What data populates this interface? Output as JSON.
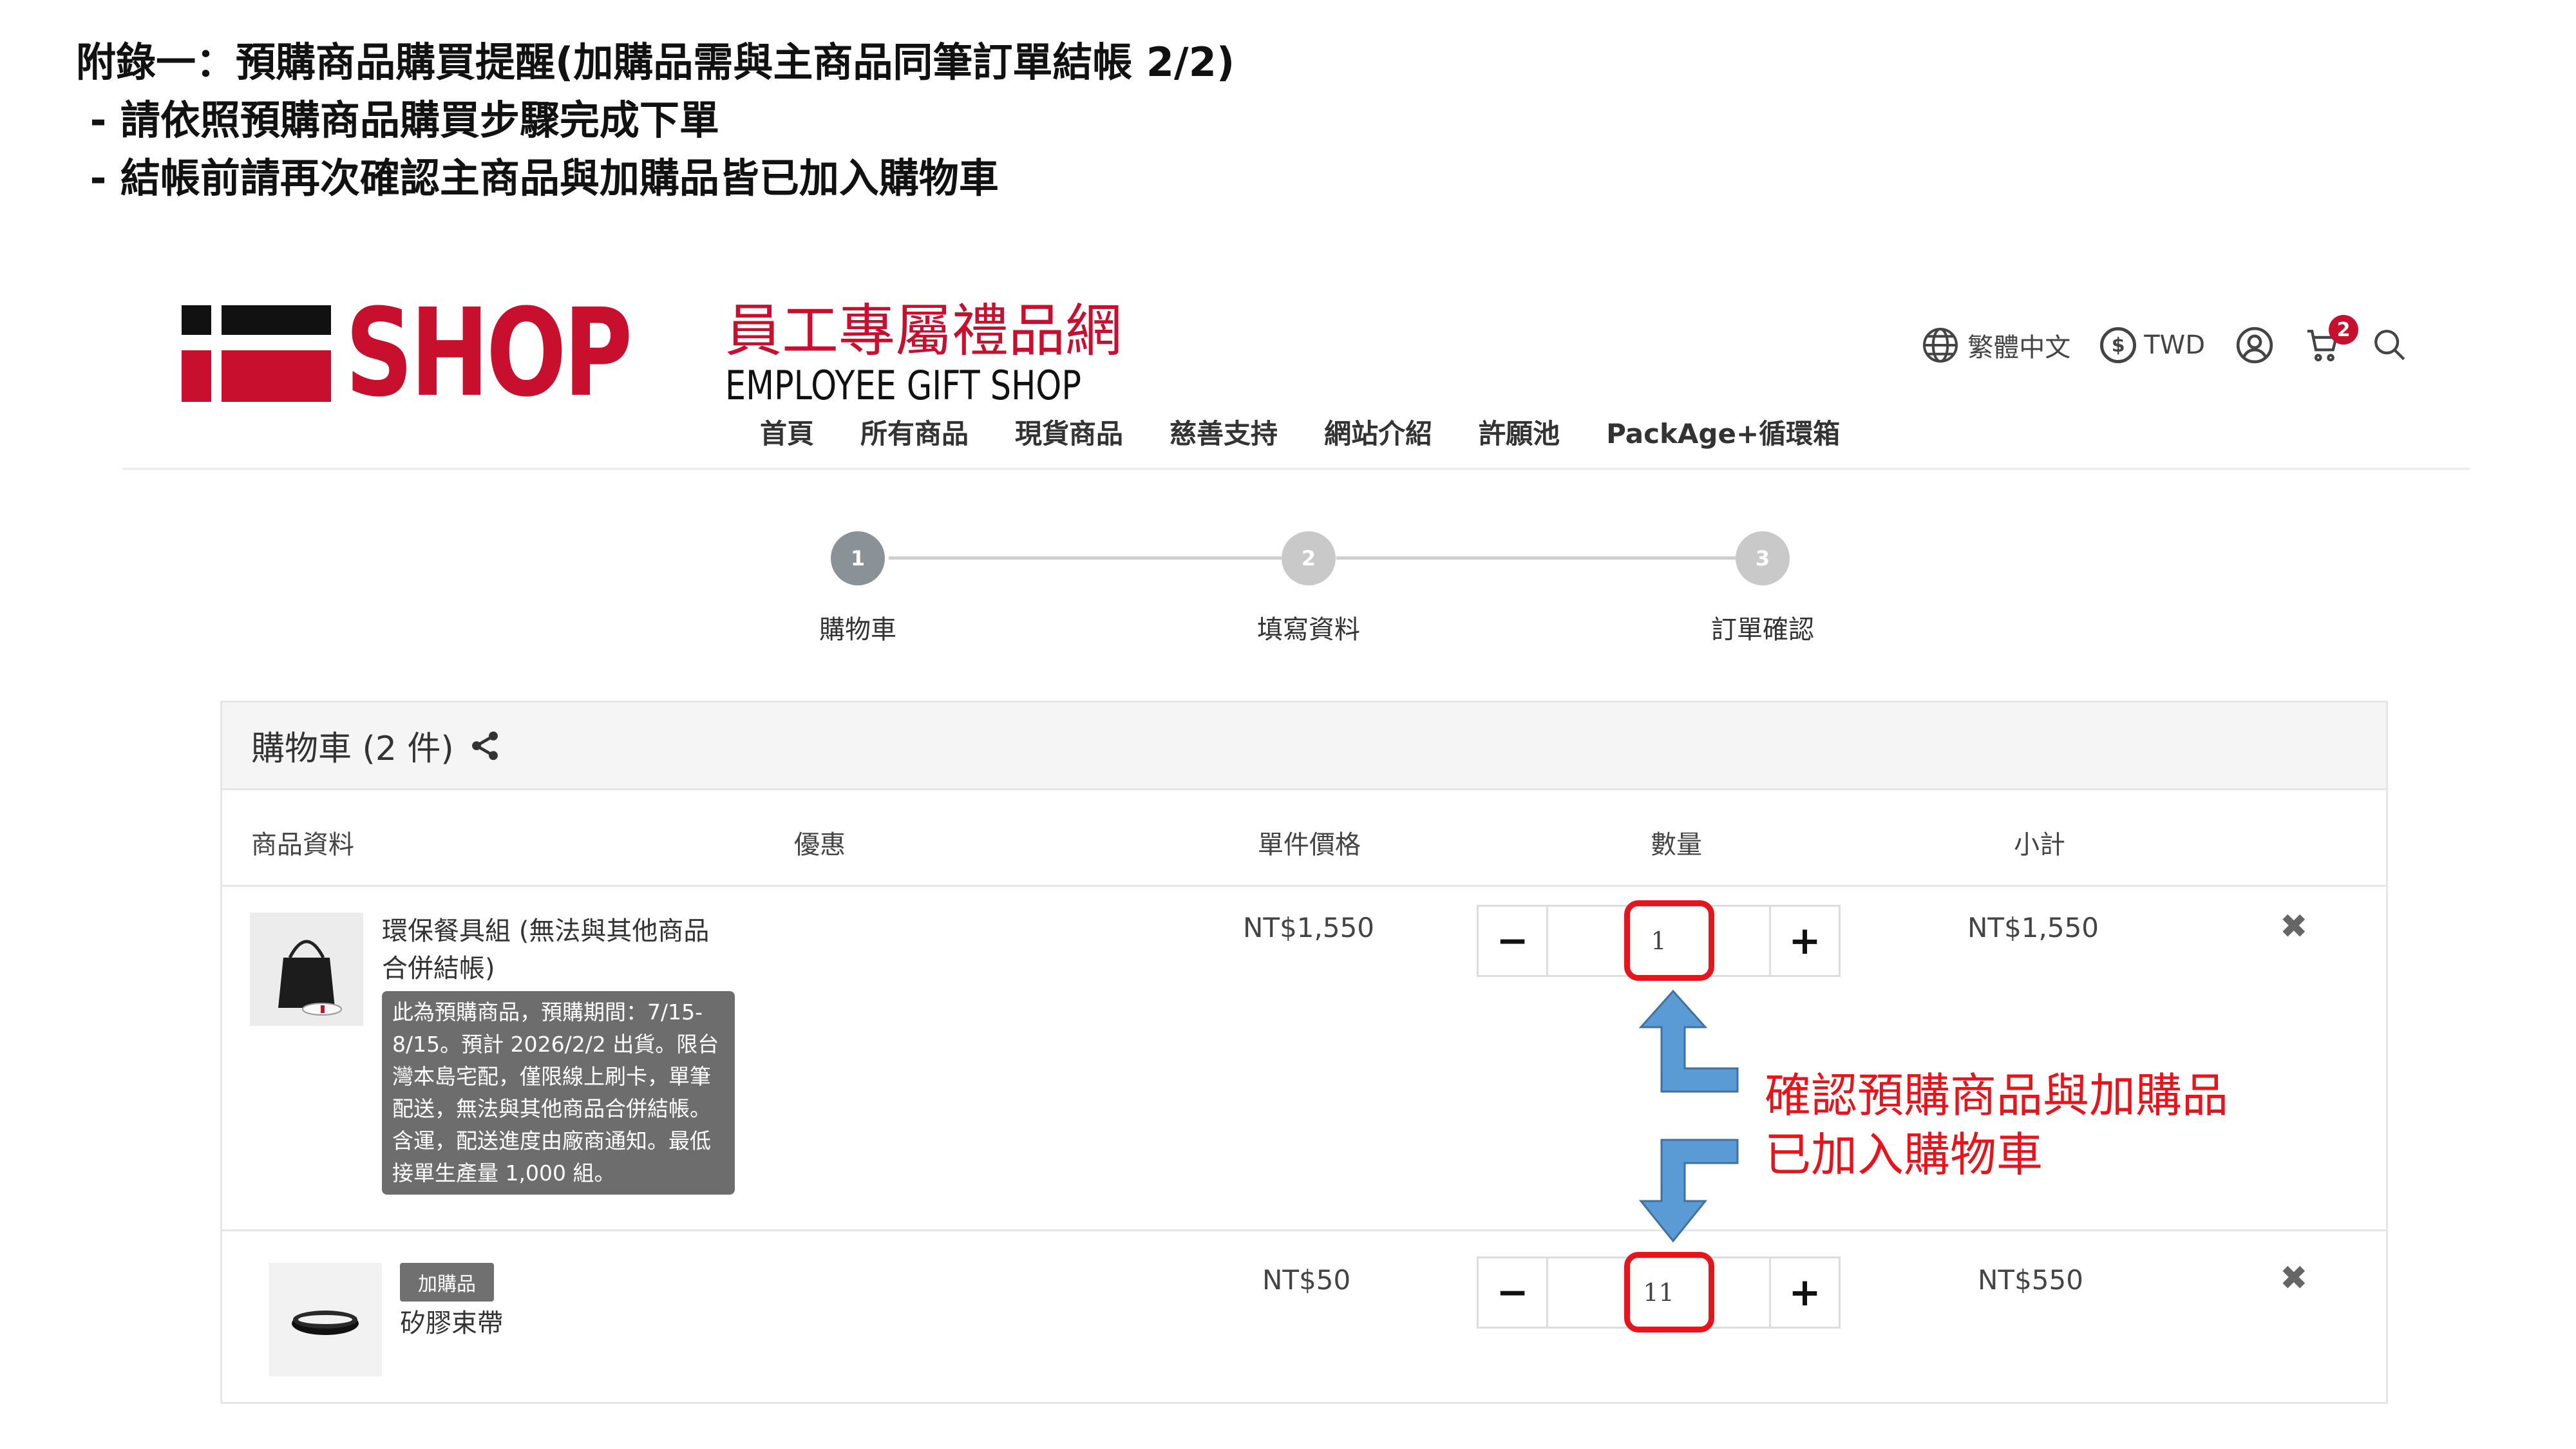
{
  "instructions": {
    "line1": "附錄一：預購商品購買提醒(加購品需與主商品同筆訂單結帳 2/2)",
    "line2": " - 請依照預購商品購買步驟完成下單",
    "line3": " - 結帳前請再次確認主商品與加購品皆已加入購物車"
  },
  "header": {
    "logo_shop": "SHOP",
    "logo_zh": "員工專屬禮品網",
    "logo_en": "EMPLOYEE GIFT SHOP",
    "language": "繁體中文",
    "currency_symbol": "$",
    "currency": "TWD",
    "cart_count": "2",
    "nav": [
      "首頁",
      "所有商品",
      "現貨商品",
      "慈善支持",
      "網站介紹",
      "許願池",
      "PackAge+循環箱"
    ]
  },
  "stepper": {
    "steps": [
      {
        "num": "1",
        "label": "購物車",
        "active": true
      },
      {
        "num": "2",
        "label": "填寫資料",
        "active": false
      },
      {
        "num": "3",
        "label": "訂單確認",
        "active": false
      }
    ]
  },
  "cart": {
    "title": "購物車 (2 件)",
    "columns": {
      "product": "商品資料",
      "discount": "優惠",
      "unit_price": "單件價格",
      "quantity": "數量",
      "subtotal": "小計"
    },
    "items": [
      {
        "name_line1": "環保餐具組 (無法與其他商品",
        "name_line2": "合併結帳)",
        "note": "此為預購商品，預購期間：7/15-8/15。預計 2026/2/2 出貨。限台灣本島宅配，僅限線上刷卡，單筆配送，無法與其他商品合併結帳。含運，配送進度由廠商通知。最低接單生產量 1,000 組。",
        "unit_price": "NT$1,550",
        "quantity": "1",
        "subtotal": "NT$1,550"
      },
      {
        "tag": "加購品",
        "name": "矽膠束帶",
        "unit_price": "NT$50",
        "quantity": "11",
        "subtotal": "NT$550"
      }
    ],
    "minus": "−",
    "plus": "+",
    "remove": "✖"
  },
  "annotation": {
    "line1": "確認預購商品與加購品",
    "line2": "已加入購物車",
    "color": "#e8141b",
    "arrow_color": "#5b9bd5"
  }
}
